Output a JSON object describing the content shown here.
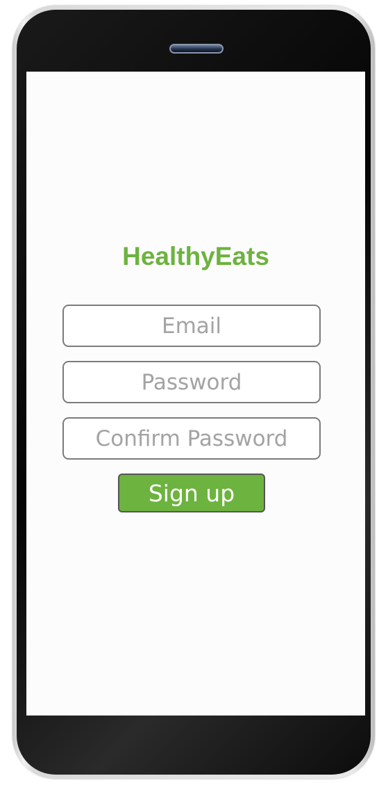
{
  "app": {
    "title": "HealthyEats"
  },
  "form": {
    "email_placeholder": "Email",
    "email_value": "",
    "password_placeholder": "Password",
    "password_value": "",
    "confirm_placeholder": "Confirm Password",
    "confirm_value": "",
    "submit_label": "Sign up"
  },
  "colors": {
    "brand_green": "#6db33f",
    "placeholder_gray": "#a3a3a3",
    "field_border": "#7b7b7b",
    "phone_frame": "#050505"
  },
  "icons": {
    "speaker": "earpiece-speaker-icon"
  }
}
